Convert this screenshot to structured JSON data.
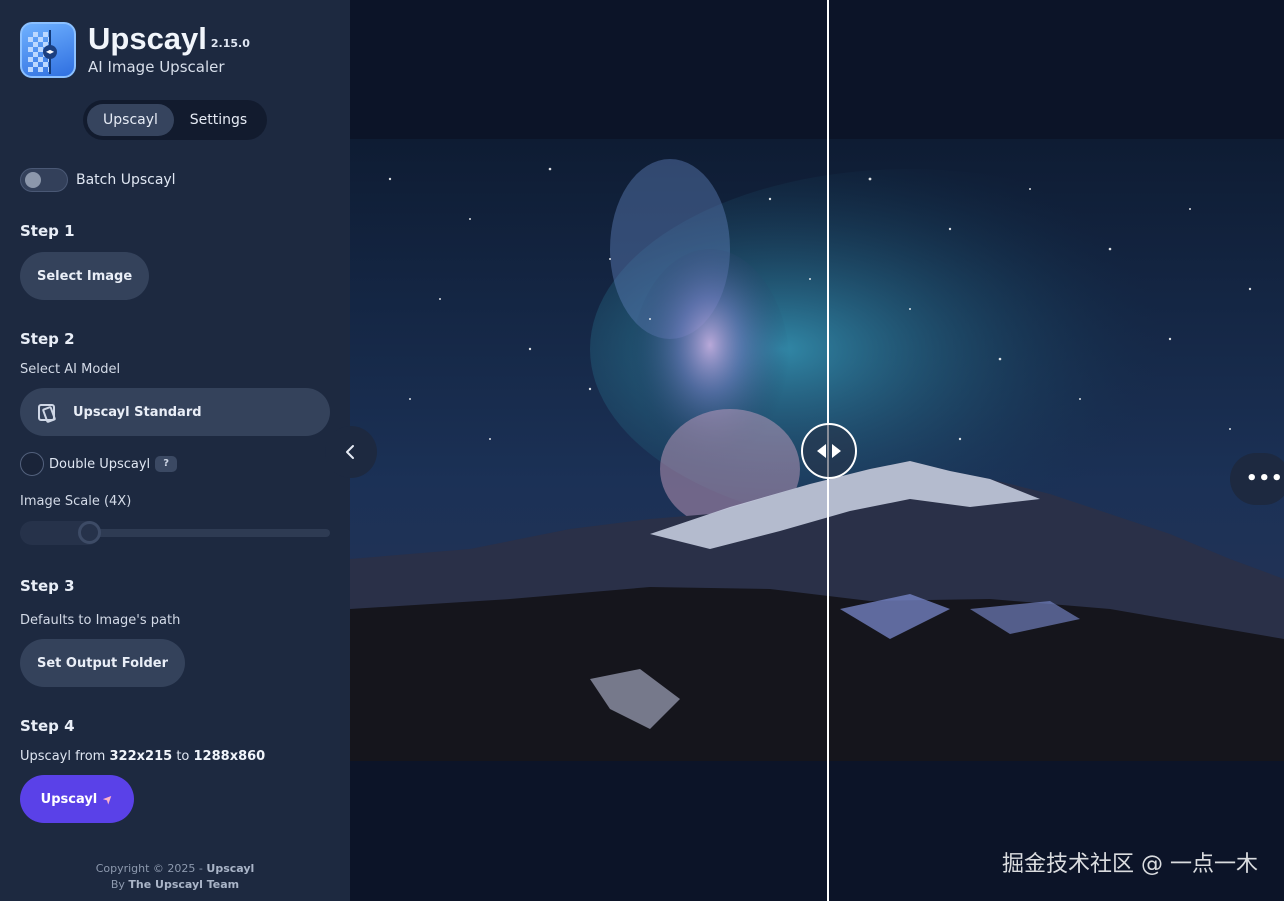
{
  "app": {
    "title": "Upscayl",
    "version": "2.15.0",
    "subtitle": "AI Image Upscaler"
  },
  "tabs": [
    {
      "label": "Upscayl",
      "active": true
    },
    {
      "label": "Settings",
      "active": false
    }
  ],
  "batch": {
    "label": "Batch Upscayl",
    "enabled": false
  },
  "step1": {
    "title": "Step 1",
    "button": "Select Image"
  },
  "step2": {
    "title": "Step 2",
    "model_label": "Select AI Model",
    "model_value": "Upscayl Standard",
    "double_label": "Double Upscayl",
    "help_badge": "?",
    "scale_label": "Image Scale (4X)",
    "scale_value": 4
  },
  "step3": {
    "title": "Step 3",
    "hint": "Defaults to Image's path",
    "button": "Set Output Folder"
  },
  "step4": {
    "title": "Step 4",
    "prefix": "Upscayl from",
    "from_size": "322x215",
    "connector": "to",
    "to_size": "1288x860",
    "button": "Upscayl",
    "button_icon": "rocket-icon"
  },
  "footer": {
    "copyright": "Copyright © 2025 -",
    "brand": "Upscayl",
    "by": "By",
    "team": "The Upscayl Team"
  },
  "preview": {
    "compare_position_percent": 51
  },
  "watermark": "掘金技术社区 @ 一点一木",
  "colors": {
    "sidebar_bg": "#1d2940",
    "primary": "#5a41e8",
    "soft_button": "#34425b"
  }
}
